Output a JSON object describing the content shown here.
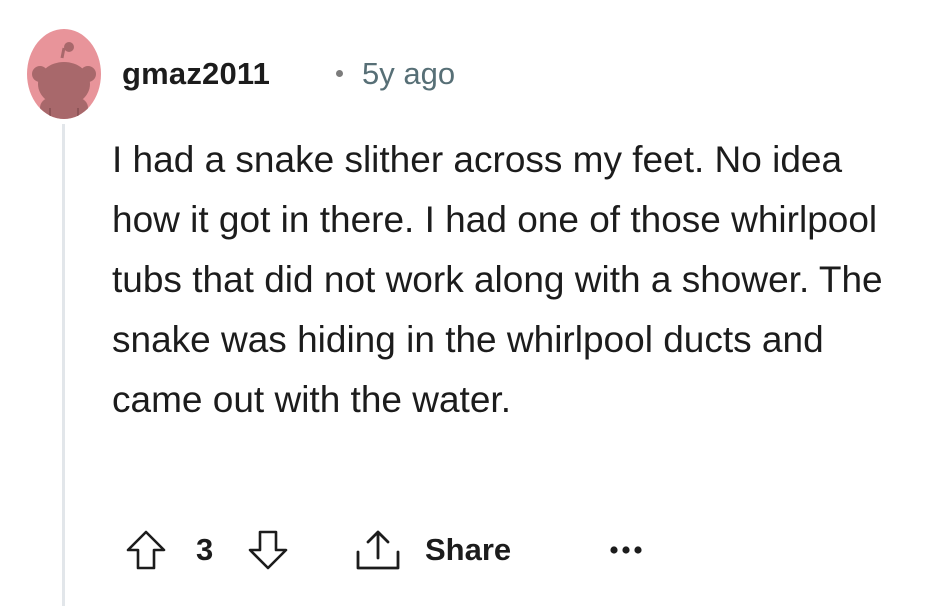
{
  "comment": {
    "author": "gmaz2011",
    "separator": "•",
    "timestamp": "5y ago",
    "body": "I had a snake slither across my feet. No idea how it got in there. I had one of those whirlpool tubs that did not work along with a shower. The snake was hiding in the whirlpool ducts and came out with the water.",
    "score": "3",
    "share_label": "Share"
  },
  "icons": {
    "avatar": "snoo-avatar-icon",
    "upvote": "arrow-up-icon",
    "downvote": "arrow-down-icon",
    "share": "share-icon",
    "more": "more-options-icon"
  },
  "colors": {
    "avatar_bg": "#E8949A",
    "thread_line": "#E2E6EA",
    "timestamp": "#576F76",
    "text": "#1C1C1C"
  }
}
